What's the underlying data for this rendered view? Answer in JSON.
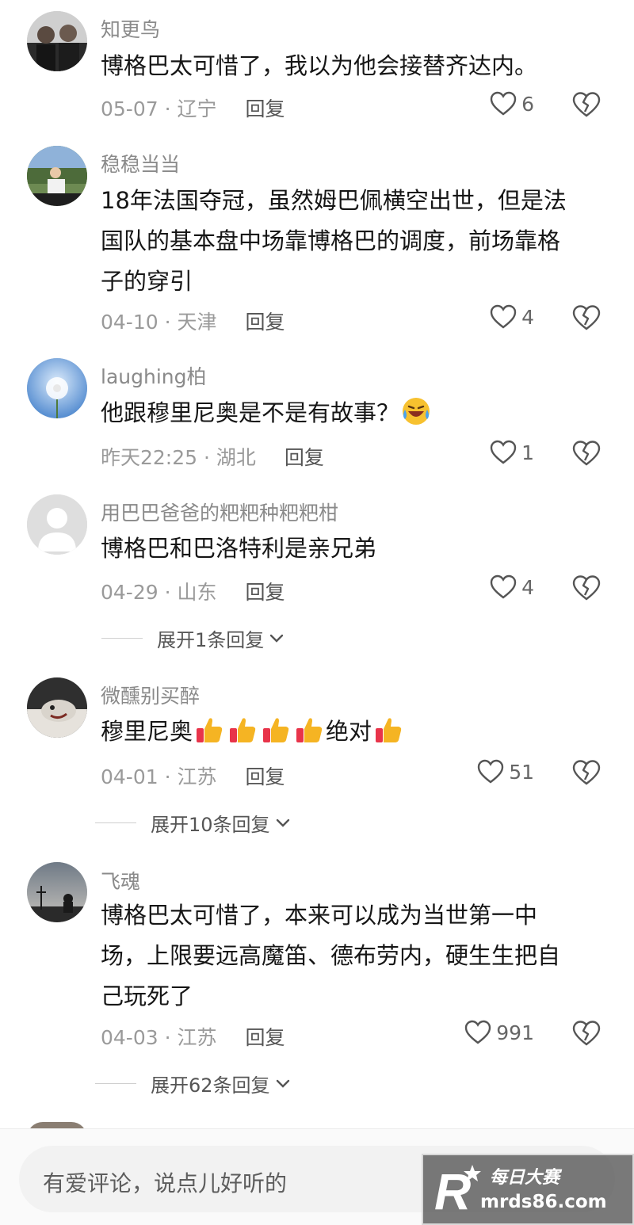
{
  "comments": [
    {
      "username": "知更鸟",
      "lines": [
        "博格巴太可惜了，我以为他会接替齐达内。"
      ],
      "date": "05-07",
      "location": "辽宁",
      "reply": "回复",
      "likes": "6"
    },
    {
      "username": "稳稳当当",
      "lines": [
        "18年法国夺冠，虽然姆巴佩横空出世，但是法",
        "国队的基本盘中场靠博格巴的调度，前场靠格",
        "子的穿引"
      ],
      "date": "04-10",
      "location": "天津",
      "reply": "回复",
      "likes": "4"
    },
    {
      "username": "laughing柏",
      "lines": [
        "他跟穆里尼奥是不是有故事？"
      ],
      "date": "昨天22:25",
      "location": "湖北",
      "reply": "回复",
      "likes": "1"
    },
    {
      "username": "用巴巴爸爸的粑粑种粑粑柑",
      "lines": [
        "博格巴和巴洛特利是亲兄弟"
      ],
      "date": "04-29",
      "location": "山东",
      "reply": "回复",
      "likes": "4",
      "expand": "展开1条回复"
    },
    {
      "username": "微醺别买醉",
      "lines": [
        "穆里尼奥",
        "绝对"
      ],
      "date": "04-01",
      "location": "江苏",
      "reply": "回复",
      "likes": "51",
      "expand": "展开10条回复"
    },
    {
      "username": "飞魂",
      "lines": [
        "博格巴太可惜了，本来可以成为当世第一中",
        "场，上限要远高魔笛、德布劳内，硬生生把自",
        "己玩死了"
      ],
      "date": "04-03",
      "location": "江苏",
      "reply": "回复",
      "likes": "991",
      "expand": "展开62条回复"
    }
  ],
  "meta_separator": " · ",
  "input": {
    "placeholder": "有爱评论，说点儿好听的"
  },
  "watermark": {
    "brand_cn": "每日大赛",
    "url": "mrds86.com",
    "logo_letter": "R"
  },
  "icons": {
    "like": "heart-outline-icon",
    "dislike": "broken-heart-icon",
    "expand": "chevron-down-icon",
    "laugh_emoji": "laughing-tears-emoji",
    "thumbs_up_emoji": "thumbs-up-emoji"
  },
  "colors": {
    "username": "#8a8a8a",
    "text": "#161616",
    "meta": "#9a9a9a",
    "emoji_thumb": "#f5b423"
  }
}
